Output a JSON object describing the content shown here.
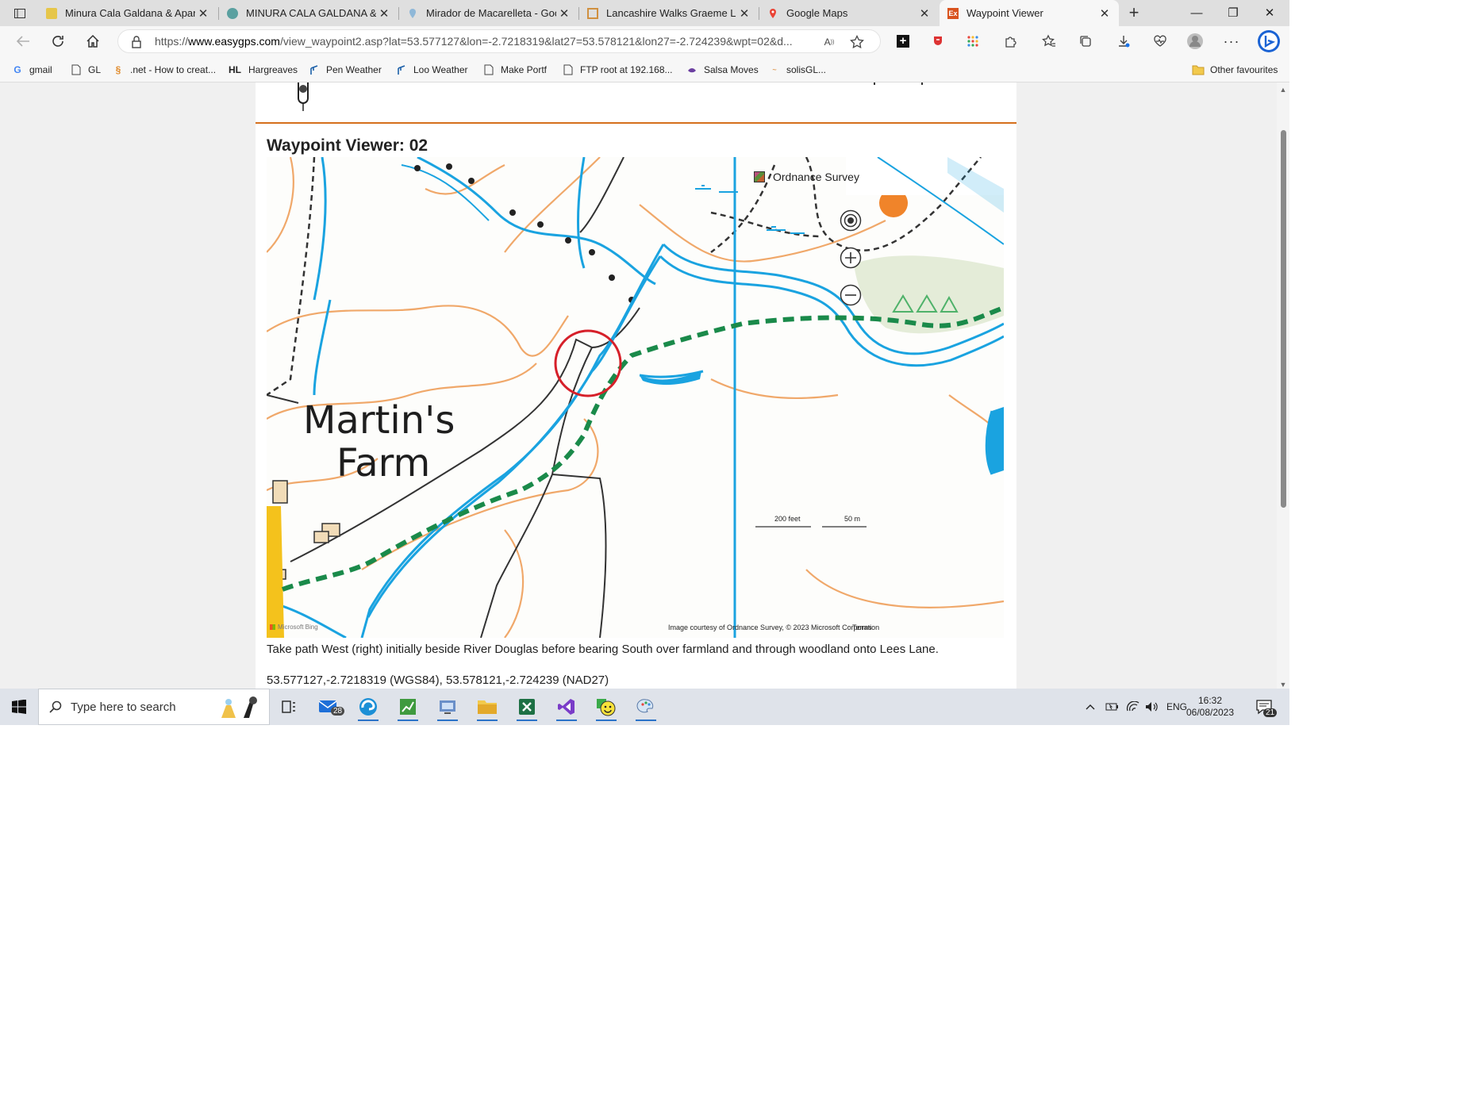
{
  "browser": {
    "tabs": [
      {
        "title": "Minura Cala Galdana & Apartm",
        "active": false
      },
      {
        "title": "MINURA CALA GALDANA & A",
        "active": false
      },
      {
        "title": "Mirador de Macarelleta - Goo",
        "active": false
      },
      {
        "title": "Lancashire Walks Graeme Link",
        "active": false
      },
      {
        "title": "Google Maps",
        "active": false
      },
      {
        "title": "Waypoint Viewer",
        "active": true
      }
    ],
    "url_prefix": "https://",
    "url_domain": "www.easygps.com",
    "url_path": "/view_waypoint2.asp?lat=53.577127&lon=-2.7218319&lat27=53.578121&lon27=-2.724239&wpt=02&d...",
    "favourites": [
      "gmail",
      "GL",
      ".net - How to creat...",
      "Hargreaves",
      "Pen Weather",
      "Loo Weather",
      "Make Portf",
      "FTP root at 192.168...",
      "Salsa Moves",
      "solisGL..."
    ],
    "other_favourites": "Other favourites"
  },
  "page": {
    "title": "Waypoint Viewer: 02",
    "map": {
      "layer_label": "Ordnance Survey",
      "place_label_1": "Martin's",
      "place_label_2": "Farm",
      "scale_feet": "200 feet",
      "scale_m": "50 m",
      "attribution": "Image courtesy of Ordnance Survey, © 2023 Microsoft Corporation",
      "terms": "Terms",
      "brand": "Microsoft Bing",
      "colors": {
        "river": "#1aa3e0",
        "contour": "#f0a86a",
        "path": "#1a8a4a",
        "marker": "#d6202a",
        "wood": "#e4ecd8"
      }
    },
    "caption": "Take path West (right) initially beside River Douglas before bearing South over farmland and through woodland onto Lees Lane.",
    "coordinates": "53.577127,-2.7218319 (WGS84), 53.578121,-2.724239 (NAD27)"
  },
  "taskbar": {
    "search_placeholder": "Type here to search",
    "mail_badge": "28",
    "language": "ENG",
    "time": "16:32",
    "date": "06/08/2023",
    "notification_count": "21"
  }
}
